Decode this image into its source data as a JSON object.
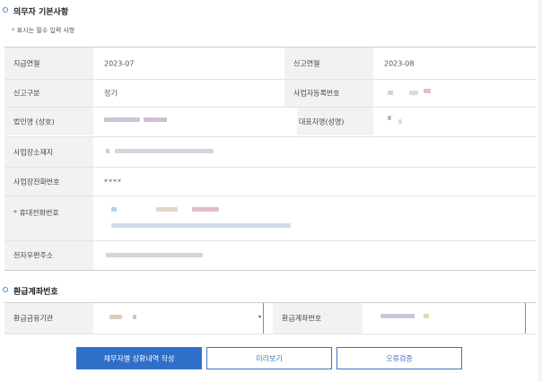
{
  "section1": {
    "title": "의무자 기본사항",
    "required_note": "표시는 필수 입력 사항",
    "required_mark": "*"
  },
  "rows": {
    "pay_month": {
      "label": "지급연월",
      "value": "2023-07"
    },
    "report_month": {
      "label": "신고연월",
      "value": "2023-08"
    },
    "report_type": {
      "label": "신고구분",
      "value": "정기"
    },
    "biz_reg_no": {
      "label": "사업자등록번호"
    },
    "corp_name": {
      "label": "법인명 (상호)"
    },
    "rep_name": {
      "label": "대표자명(성명)"
    },
    "biz_address": {
      "label": "사업장소재지"
    },
    "biz_phone": {
      "label": "사업장전화번호",
      "value": "****"
    },
    "mobile": {
      "label": "휴대전화번호",
      "required": "*"
    },
    "email": {
      "label": "전자우편주소"
    }
  },
  "section2": {
    "title": "환급계좌번호"
  },
  "refund": {
    "bank_label": "환급금융기관",
    "account_label": "환급계좌번호"
  },
  "buttons": {
    "create": "채무자별 상환내역 작성",
    "preview": "미리보기",
    "verify": "오류검증"
  },
  "colors": {
    "accent": "#2f6fc9",
    "label_bg": "#f2f2f2",
    "required": "#dd3333"
  }
}
